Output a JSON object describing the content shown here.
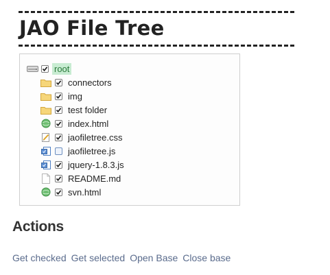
{
  "header": {
    "title": "JAO File Tree"
  },
  "tree": {
    "root": {
      "label": "root",
      "icon": "drive-icon",
      "checked": true,
      "selected": true
    },
    "items": [
      {
        "label": "connectors",
        "icon": "folder-icon",
        "checked": true
      },
      {
        "label": "img",
        "icon": "folder-icon",
        "checked": true
      },
      {
        "label": "test folder",
        "icon": "folder-icon",
        "checked": true
      },
      {
        "label": "index.html",
        "icon": "html-file-icon",
        "checked": true
      },
      {
        "label": "jaofiletree.css",
        "icon": "css-file-icon",
        "checked": true
      },
      {
        "label": "jaofiletree.js",
        "icon": "js-file-icon",
        "checked": false
      },
      {
        "label": "jquery-1.8.3.js",
        "icon": "js-file-icon",
        "checked": true
      },
      {
        "label": "README.md",
        "icon": "blank-file-icon",
        "checked": true
      },
      {
        "label": "svn.html",
        "icon": "html-file-icon",
        "checked": true
      }
    ]
  },
  "actions": {
    "title": "Actions",
    "links": [
      "Get checked",
      "Get selected",
      "Open Base",
      "Close base"
    ]
  },
  "colors": {
    "link": "#5a6b8c",
    "selected_bg": "#c8ecd2",
    "folder": "#f2c75c"
  }
}
